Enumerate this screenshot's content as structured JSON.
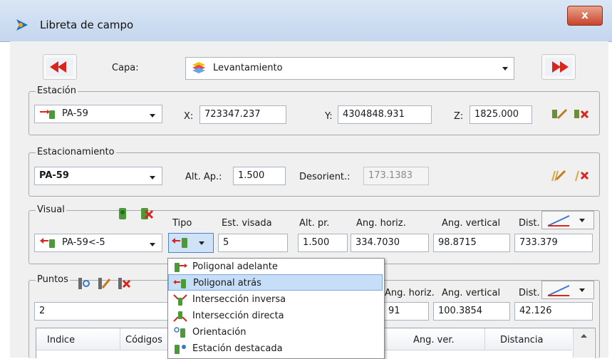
{
  "window": {
    "title": "Libreta de campo",
    "close_label": "x"
  },
  "capa": {
    "label": "Capa:",
    "value": "Levantamiento"
  },
  "estacion": {
    "legend": "Estación",
    "station": "PA-59",
    "x_label": "X:",
    "x": "723347.237",
    "y_label": "Y:",
    "y": "4304848.931",
    "z_label": "Z:",
    "z": "1825.000"
  },
  "estacionamiento": {
    "legend": "Estacionamiento",
    "station": "PA-59",
    "alt_label": "Alt. Ap.:",
    "alt": "1.500",
    "desor_label": "Desorient.:",
    "desor": "173.1383"
  },
  "visual": {
    "legend": "Visual",
    "headers": {
      "tipo": "Tipo",
      "est": "Est. visada",
      "alt": "Alt. pr.",
      "ah": "Ang. horiz.",
      "av": "Ang. vertical",
      "dist": "Dist."
    },
    "station": "PA-59<-5",
    "est": "5",
    "alt": "1.500",
    "ah": "334.7030",
    "av": "98.8715",
    "dist": "733.379"
  },
  "puntos": {
    "legend": "Puntos",
    "headers": {
      "ah": "Ang. horiz.",
      "av": "Ang. vertical",
      "dist": "Dist."
    },
    "point": "2",
    "ah_partial": "91",
    "av": "100.3854",
    "dist": "42.126",
    "table_headers": [
      "Indice",
      "Códigos",
      "Ang. ver.",
      "Distancia"
    ]
  },
  "tipo_menu": {
    "items": [
      "Poligonal adelante",
      "Poligonal atrás",
      "Intersección inversa",
      "Intersección directa",
      "Orientación",
      "Estación destacada"
    ],
    "selected": 1
  },
  "colors": {
    "accent": "#3b78c9",
    "selection": "#c6def8",
    "error_red": "#d9261c"
  }
}
